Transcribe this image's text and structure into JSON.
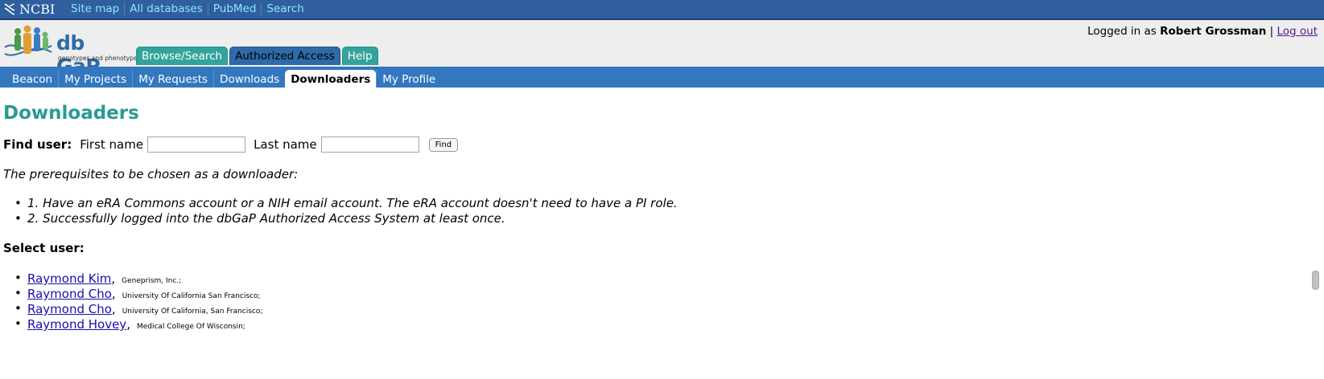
{
  "ncbi_bar": {
    "logo_text": "NCBI",
    "links": [
      "Site map",
      "All databases",
      "PubMed",
      "Search"
    ]
  },
  "header": {
    "brand": "db GaP",
    "brand_sub": "genotypes and phenotypes",
    "login_prefix": "Logged in as",
    "user_name": "Robert Grossman",
    "separator": "|",
    "logout": "Log out",
    "tabs": [
      {
        "label": "Browse/Search",
        "active": false
      },
      {
        "label": "Authorized Access",
        "active": true
      },
      {
        "label": "Help",
        "active": false
      }
    ]
  },
  "subnav": {
    "items": [
      "Beacon",
      "My Projects",
      "My Requests",
      "Downloads",
      "Downloaders",
      "My Profile"
    ],
    "active": "Downloaders"
  },
  "main": {
    "title": "Downloaders",
    "find": {
      "label": "Find user:",
      "first_name_label": "First name",
      "first_name_value": "",
      "last_name_label": "Last name",
      "last_name_value": "",
      "find_button": "Find"
    },
    "prereq_title": "The prerequisites to be chosen as a downloader:",
    "prereqs": [
      "1. Have an eRA Commons account or a NIH email account. The eRA account doesn't need to have a PI role.",
      "2. Successfully logged into the dbGaP Authorized Access System at least once."
    ],
    "select_label": "Select user:",
    "users": [
      {
        "name": "Raymond Kim",
        "org": "Geneprism, Inc.;"
      },
      {
        "name": "Raymond Cho",
        "org": "University Of California San Francisco;"
      },
      {
        "name": "Raymond Cho",
        "org": "University Of California, San Francisco;"
      },
      {
        "name": "Raymond Hovey",
        "org": "Medical College Of Wisconsin;"
      }
    ]
  },
  "colors": {
    "ncbi_bar": "#2f5f9e",
    "subnav": "#3377bf",
    "teal_tab": "#34a39c",
    "title": "#2a9a95"
  }
}
